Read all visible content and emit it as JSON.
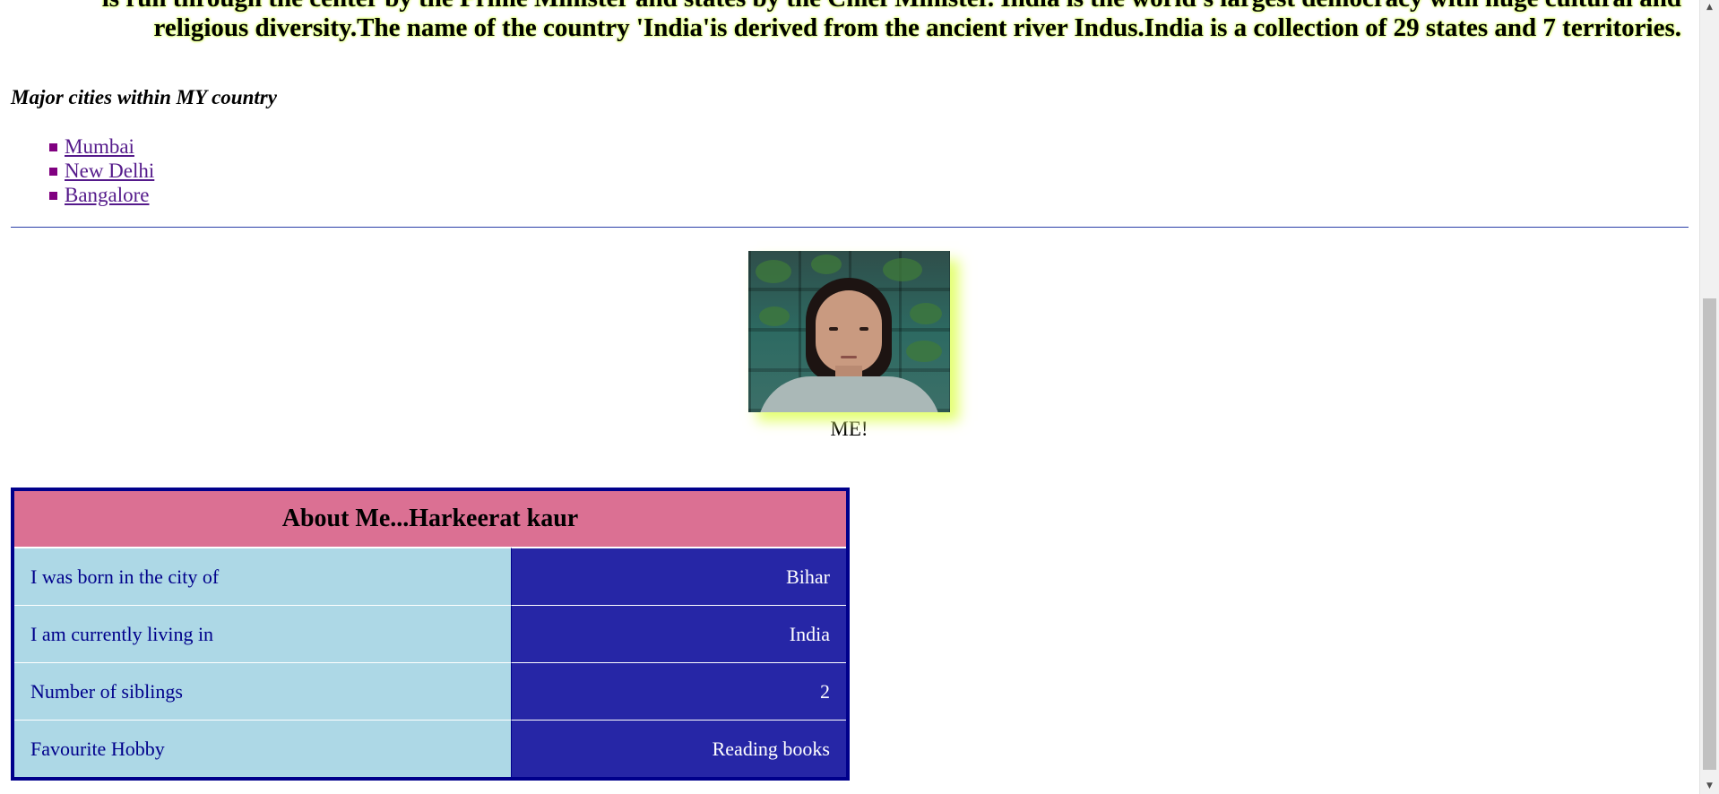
{
  "intro": {
    "line1": "is run through the center by the Prime Minister and states by the Chief Minister. India is the world's largest democracy with huge cultural and",
    "line2": "religious diversity.The name of the country 'India'is derived from the ancient river Indus.India is a collection of 29 states and 7 territories."
  },
  "cities": {
    "heading": "Major cities within MY country",
    "items": [
      {
        "label": "Mumbai"
      },
      {
        "label": "New Delhi"
      },
      {
        "label": "Bangalore"
      }
    ]
  },
  "photo": {
    "caption": "ME!"
  },
  "about_table": {
    "title": "About Me...Harkeerat kaur",
    "rows": [
      {
        "label": "I was born in the city of",
        "value": "Bihar"
      },
      {
        "label": "I am currently living in",
        "value": "India"
      },
      {
        "label": "Number of siblings",
        "value": "2"
      },
      {
        "label": "Favourite Hobby",
        "value": "Reading books"
      }
    ]
  },
  "scrollbar": {
    "up_icon": "▲",
    "down_icon": "▼"
  },
  "colors": {
    "table_header": "#db7093",
    "label_cell": "#add8e6",
    "value_cell": "#2626a6",
    "table_border": "#00008b",
    "text_glow": "#dfff70",
    "bullet": "#800080"
  }
}
